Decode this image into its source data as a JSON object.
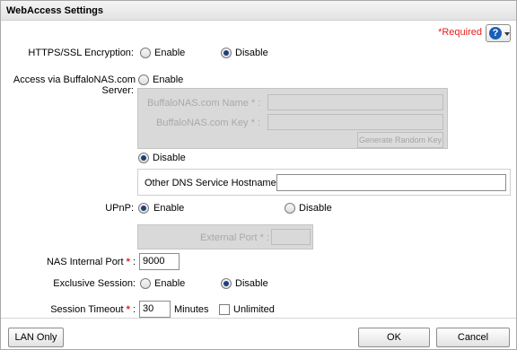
{
  "dialog": {
    "title": "WebAccess Settings",
    "required_note": "*Required",
    "help_icon": "question-icon"
  },
  "https": {
    "label": "HTTPS/SSL Encryption:",
    "enable": "Enable",
    "disable": "Disable",
    "selected": "Disable"
  },
  "buffalo": {
    "label_line1": "Access via BuffaloNAS.com",
    "label_line2": "Server:",
    "enable": "Enable",
    "name_label": "BuffaloNAS.com Name",
    "key_label": "BuffaloNAS.com Key",
    "required_mark": "*",
    "colon": ":",
    "generate_button": "Generate Random Key",
    "disable": "Disable",
    "selected": "Disable",
    "dns_label": "Other DNS Service Hostname",
    "dns_value": ""
  },
  "upnp": {
    "label": "UPnP:",
    "enable": "Enable",
    "disable": "Disable",
    "selected": "Enable",
    "external_port_label": "External Port"
  },
  "nas_port": {
    "label": "NAS Internal Port",
    "required_mark": "*",
    "colon": ":",
    "value": "9000"
  },
  "exclusive": {
    "label": "Exclusive Session:",
    "enable": "Enable",
    "disable": "Disable",
    "selected": "Disable"
  },
  "timeout": {
    "label": "Session Timeout",
    "required_mark": "*",
    "colon": ":",
    "value": "30",
    "unit": "Minutes",
    "unlimited": "Unlimited",
    "unlimited_checked": false
  },
  "footer": {
    "lan_only": "LAN Only",
    "ok": "OK",
    "cancel": "Cancel"
  },
  "colors": {
    "required": "#e02020",
    "radio_dot": "#1f3f7a",
    "disabled_panel": "#d9d9d9",
    "help_blue": "#1a5fb4"
  }
}
